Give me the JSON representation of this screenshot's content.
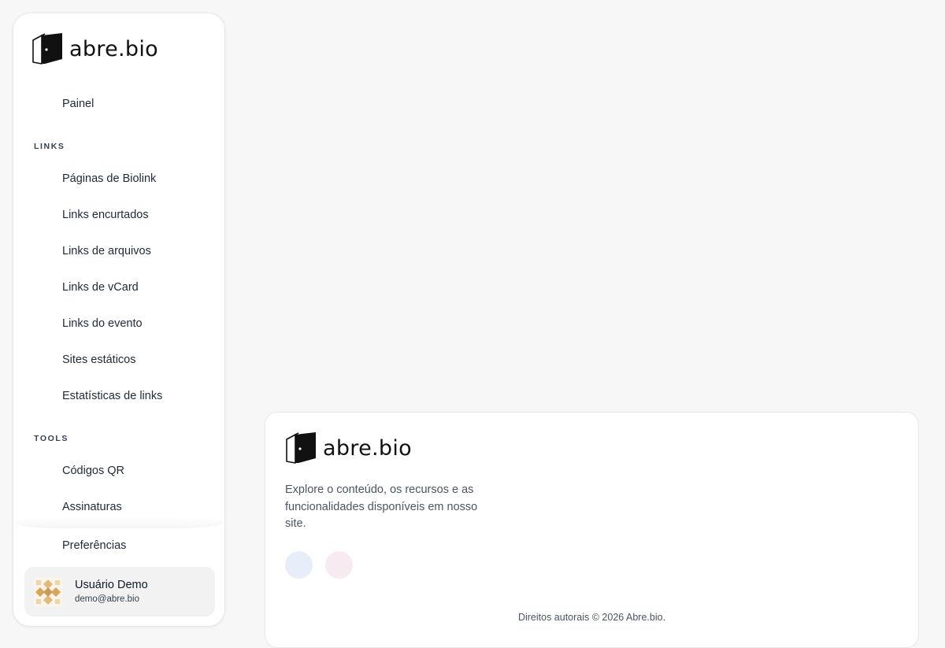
{
  "brand": {
    "name": "abre.bio"
  },
  "sidebar": {
    "top_items": [
      {
        "label": "Painel",
        "icon": "dashboard-icon"
      }
    ],
    "sections": [
      {
        "label": "LINKS",
        "items": [
          {
            "label": "Páginas de Biolink",
            "icon": "biolink-icon"
          },
          {
            "label": "Links encurtados",
            "icon": "link-icon"
          },
          {
            "label": "Links de arquivos",
            "icon": "file-icon"
          },
          {
            "label": "Links de vCard",
            "icon": "vcard-icon"
          },
          {
            "label": "Links do evento",
            "icon": "calendar-icon"
          },
          {
            "label": "Sites estáticos",
            "icon": "site-icon"
          },
          {
            "label": "Estatísticas de links",
            "icon": "chart-icon"
          }
        ]
      },
      {
        "label": "TOOLS",
        "items": [
          {
            "label": "Códigos QR",
            "icon": "qr-icon"
          },
          {
            "label": "Assinaturas",
            "icon": "signature-icon"
          }
        ]
      }
    ],
    "bottom_items": [
      {
        "label": "Preferências",
        "icon": "settings-icon"
      }
    ]
  },
  "user": {
    "name": "Usuário Demo",
    "email": "demo@abre.bio"
  },
  "footer": {
    "description": "Explore o conteúdo, os recursos e as funcionalidades disponíveis em nosso site.",
    "social": [
      {
        "icon": "social-icon-blue",
        "color": "#e8eef9"
      },
      {
        "icon": "social-icon-pink",
        "color": "#f7ebf1"
      }
    ],
    "copyright": "Direitos autorais © 2026 Abre.bio."
  }
}
